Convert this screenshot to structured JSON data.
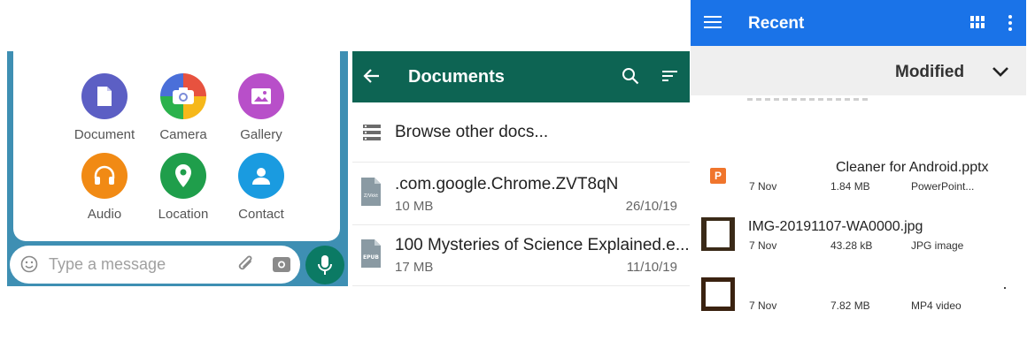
{
  "attach": {
    "items": [
      {
        "label": "Document",
        "icon": "document-icon",
        "color": "#5c5fc4"
      },
      {
        "label": "Camera",
        "icon": "camera-icon",
        "color": "#e7523f"
      },
      {
        "label": "Gallery",
        "icon": "gallery-icon",
        "color": "#b84fc9"
      },
      {
        "label": "Audio",
        "icon": "headphones-icon",
        "color": "#f18a14"
      },
      {
        "label": "Location",
        "icon": "location-icon",
        "color": "#1f9e4b"
      },
      {
        "label": "Contact",
        "icon": "contact-icon",
        "color": "#1a9be0"
      }
    ],
    "placeholder": "Type a message"
  },
  "documents": {
    "title": "Documents",
    "browse_label": "Browse other docs...",
    "files": [
      {
        "name": ".com.google.Chrome.ZVT8qN",
        "size": "10 MB",
        "date": "26/10/19",
        "badge": ""
      },
      {
        "name": "100 Mysteries of Science Explained.e...",
        "size": "17 MB",
        "date": "11/10/19",
        "badge": "EPUB"
      }
    ]
  },
  "recent": {
    "title": "Recent",
    "sort_label": "Modified",
    "files": [
      {
        "name": "Cleaner for Android.pptx",
        "date": "7 Nov",
        "size": "1.84 MB",
        "type": "PowerPoint...",
        "thumb": "pptx-icon"
      },
      {
        "name": "IMG-20191107-WA0000.jpg",
        "date": "7 Nov",
        "size": "43.28 kB",
        "type": "JPG image",
        "thumb": "image-thumbnail"
      },
      {
        "name": "",
        "date": "7 Nov",
        "size": "7.82 MB",
        "type": "MP4 video",
        "thumb": "video-thumbnail"
      }
    ]
  }
}
